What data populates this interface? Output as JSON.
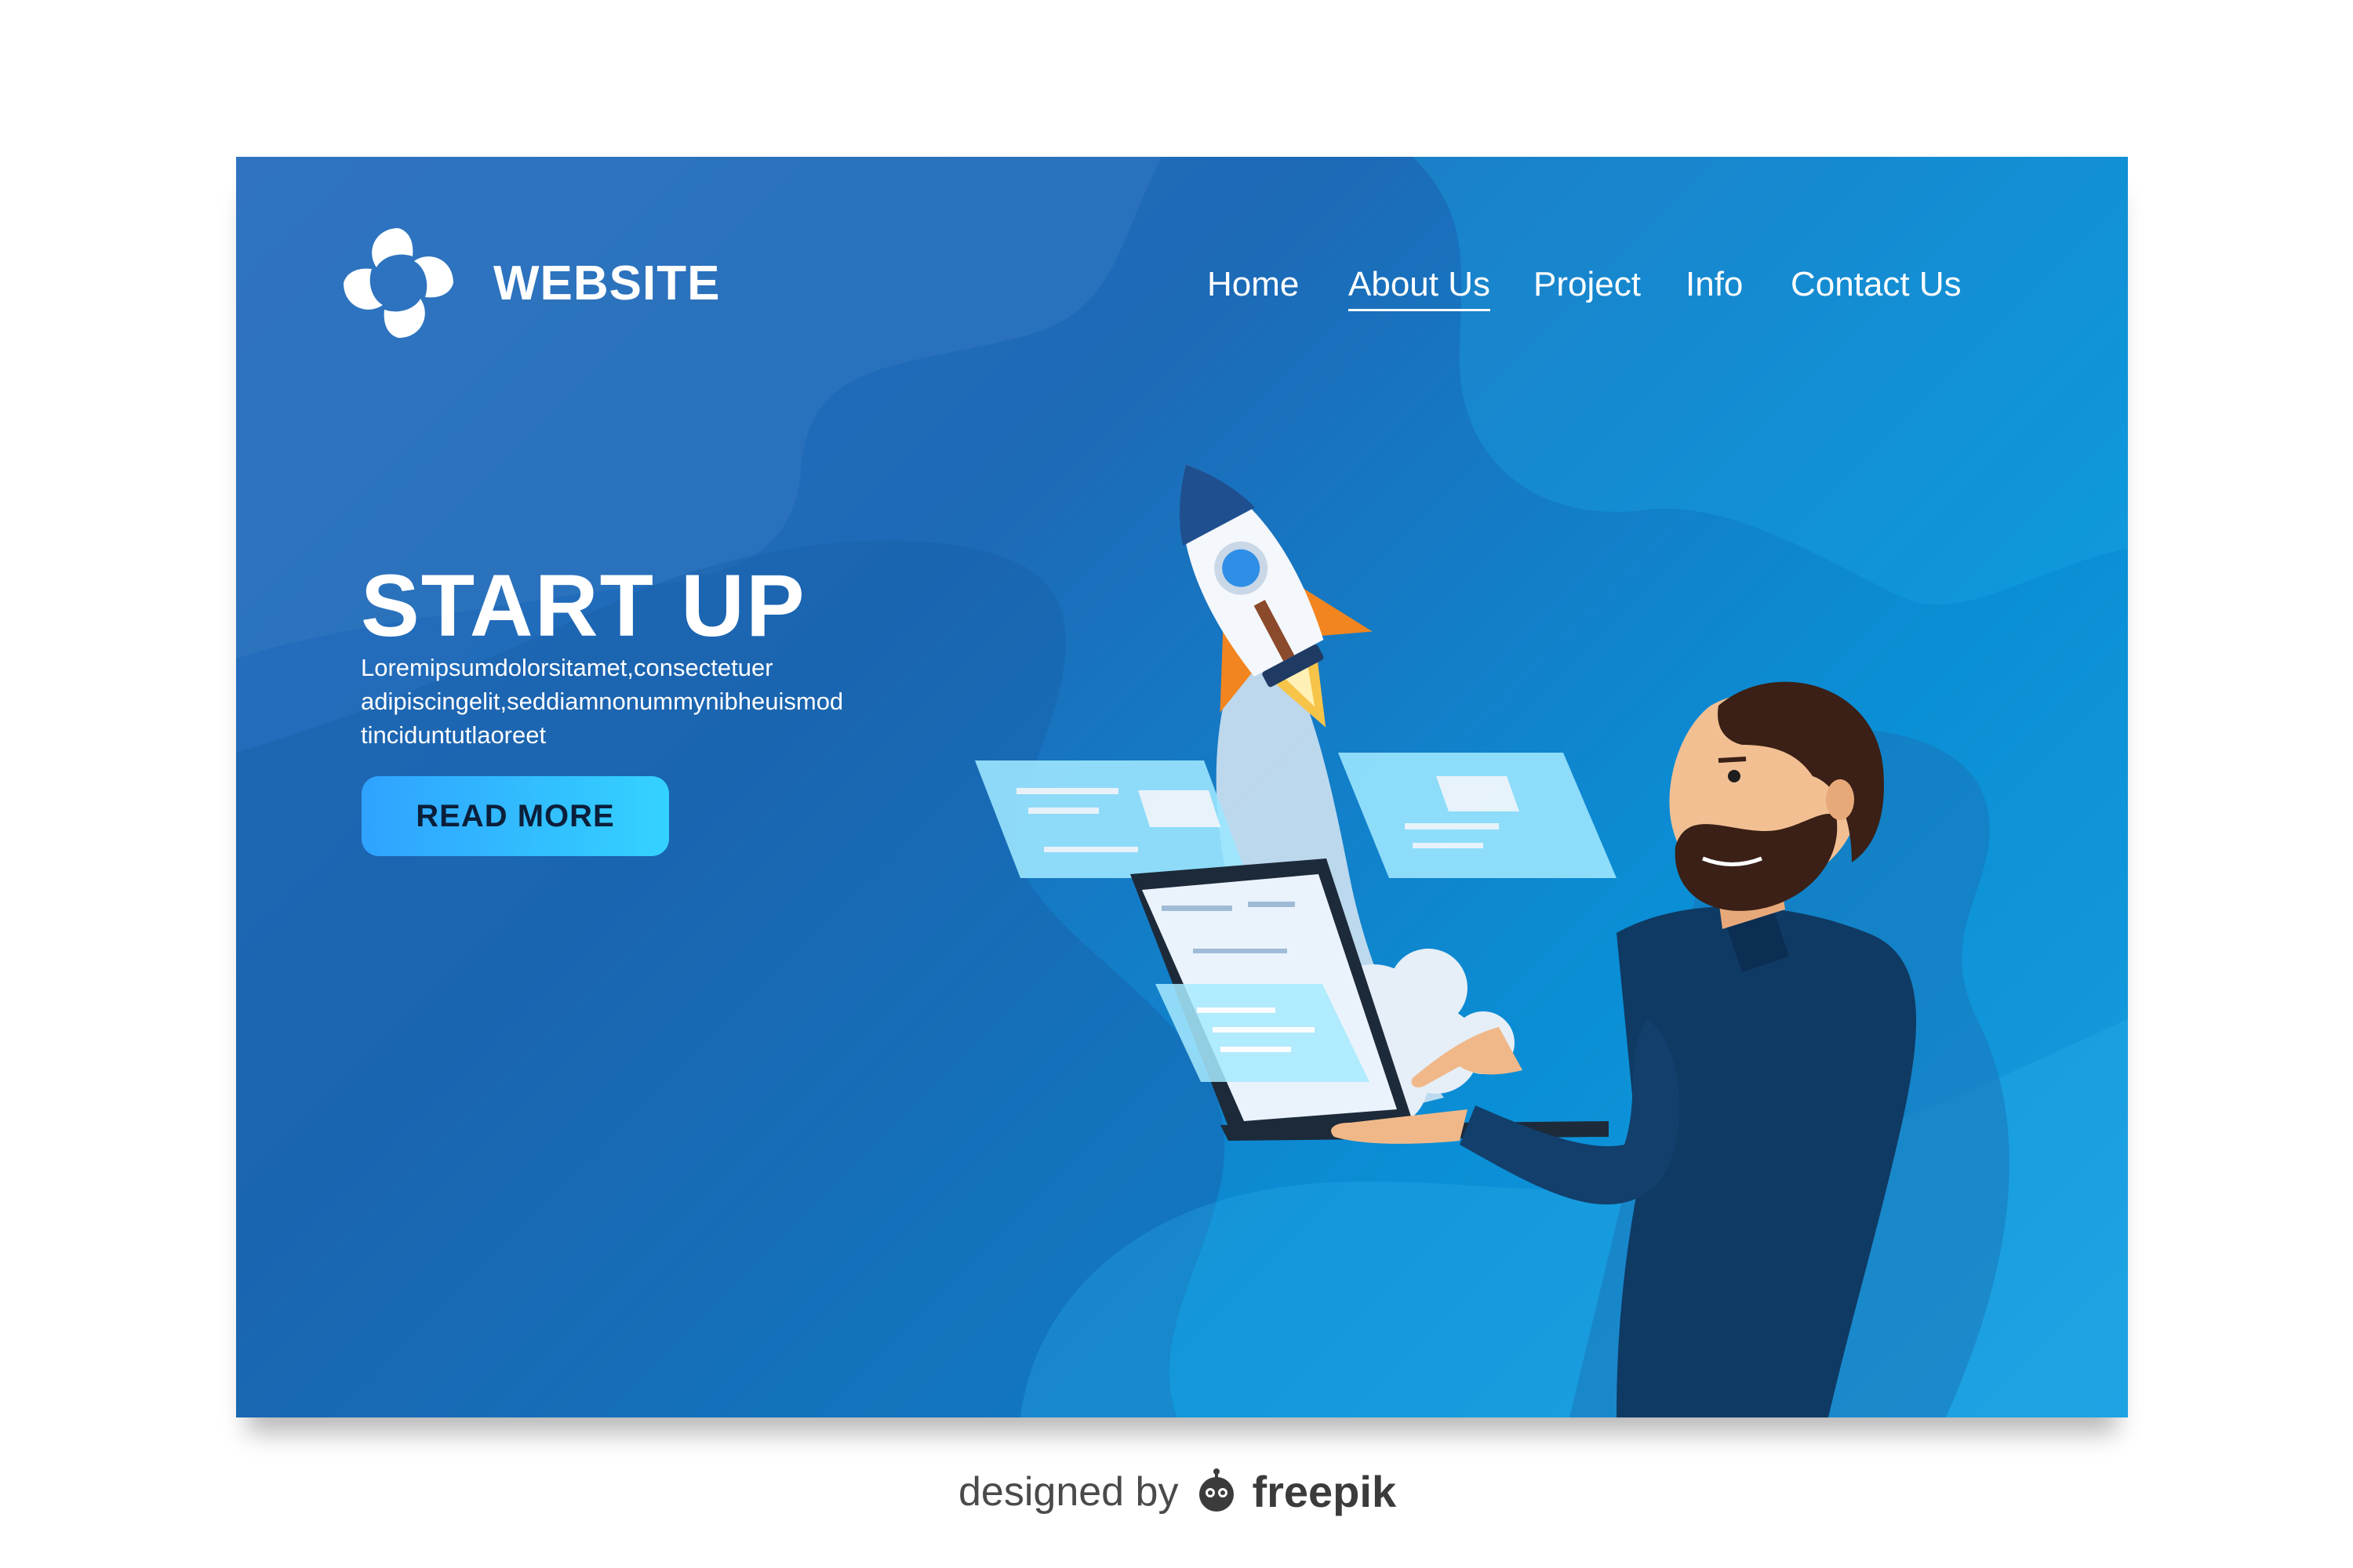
{
  "brand": {
    "name": "WEBSITE",
    "logo_icon": "swirl-logo-icon"
  },
  "nav": {
    "items": [
      {
        "label": "Home",
        "active": false
      },
      {
        "label": "About Us",
        "active": true
      },
      {
        "label": "Project",
        "active": false
      },
      {
        "label": "Info",
        "active": false
      },
      {
        "label": "Contact Us",
        "active": false
      }
    ]
  },
  "hero": {
    "title": "START UP",
    "description_lines": [
      "Loremipsumdolorsitamet,consectetuer",
      "adipiscingelit,seddiamnonummynibheuismod",
      "tinciduntutlaoreet"
    ],
    "cta_label": "READ MORE"
  },
  "illustration": {
    "icons": [
      "rocket-icon",
      "laptop-icon",
      "person-illustration",
      "floating-window-icon"
    ]
  },
  "credit": {
    "prefix": "designed by",
    "brand": "freepik",
    "icon": "freepik-robot-icon"
  },
  "colors": {
    "background_start": "#2a6fc0",
    "background_end": "#1a9ee0",
    "button_start": "#2fa3ff",
    "button_end": "#34d2ff",
    "text_light": "#ffffff",
    "text_dark": "#0b1f3a"
  }
}
